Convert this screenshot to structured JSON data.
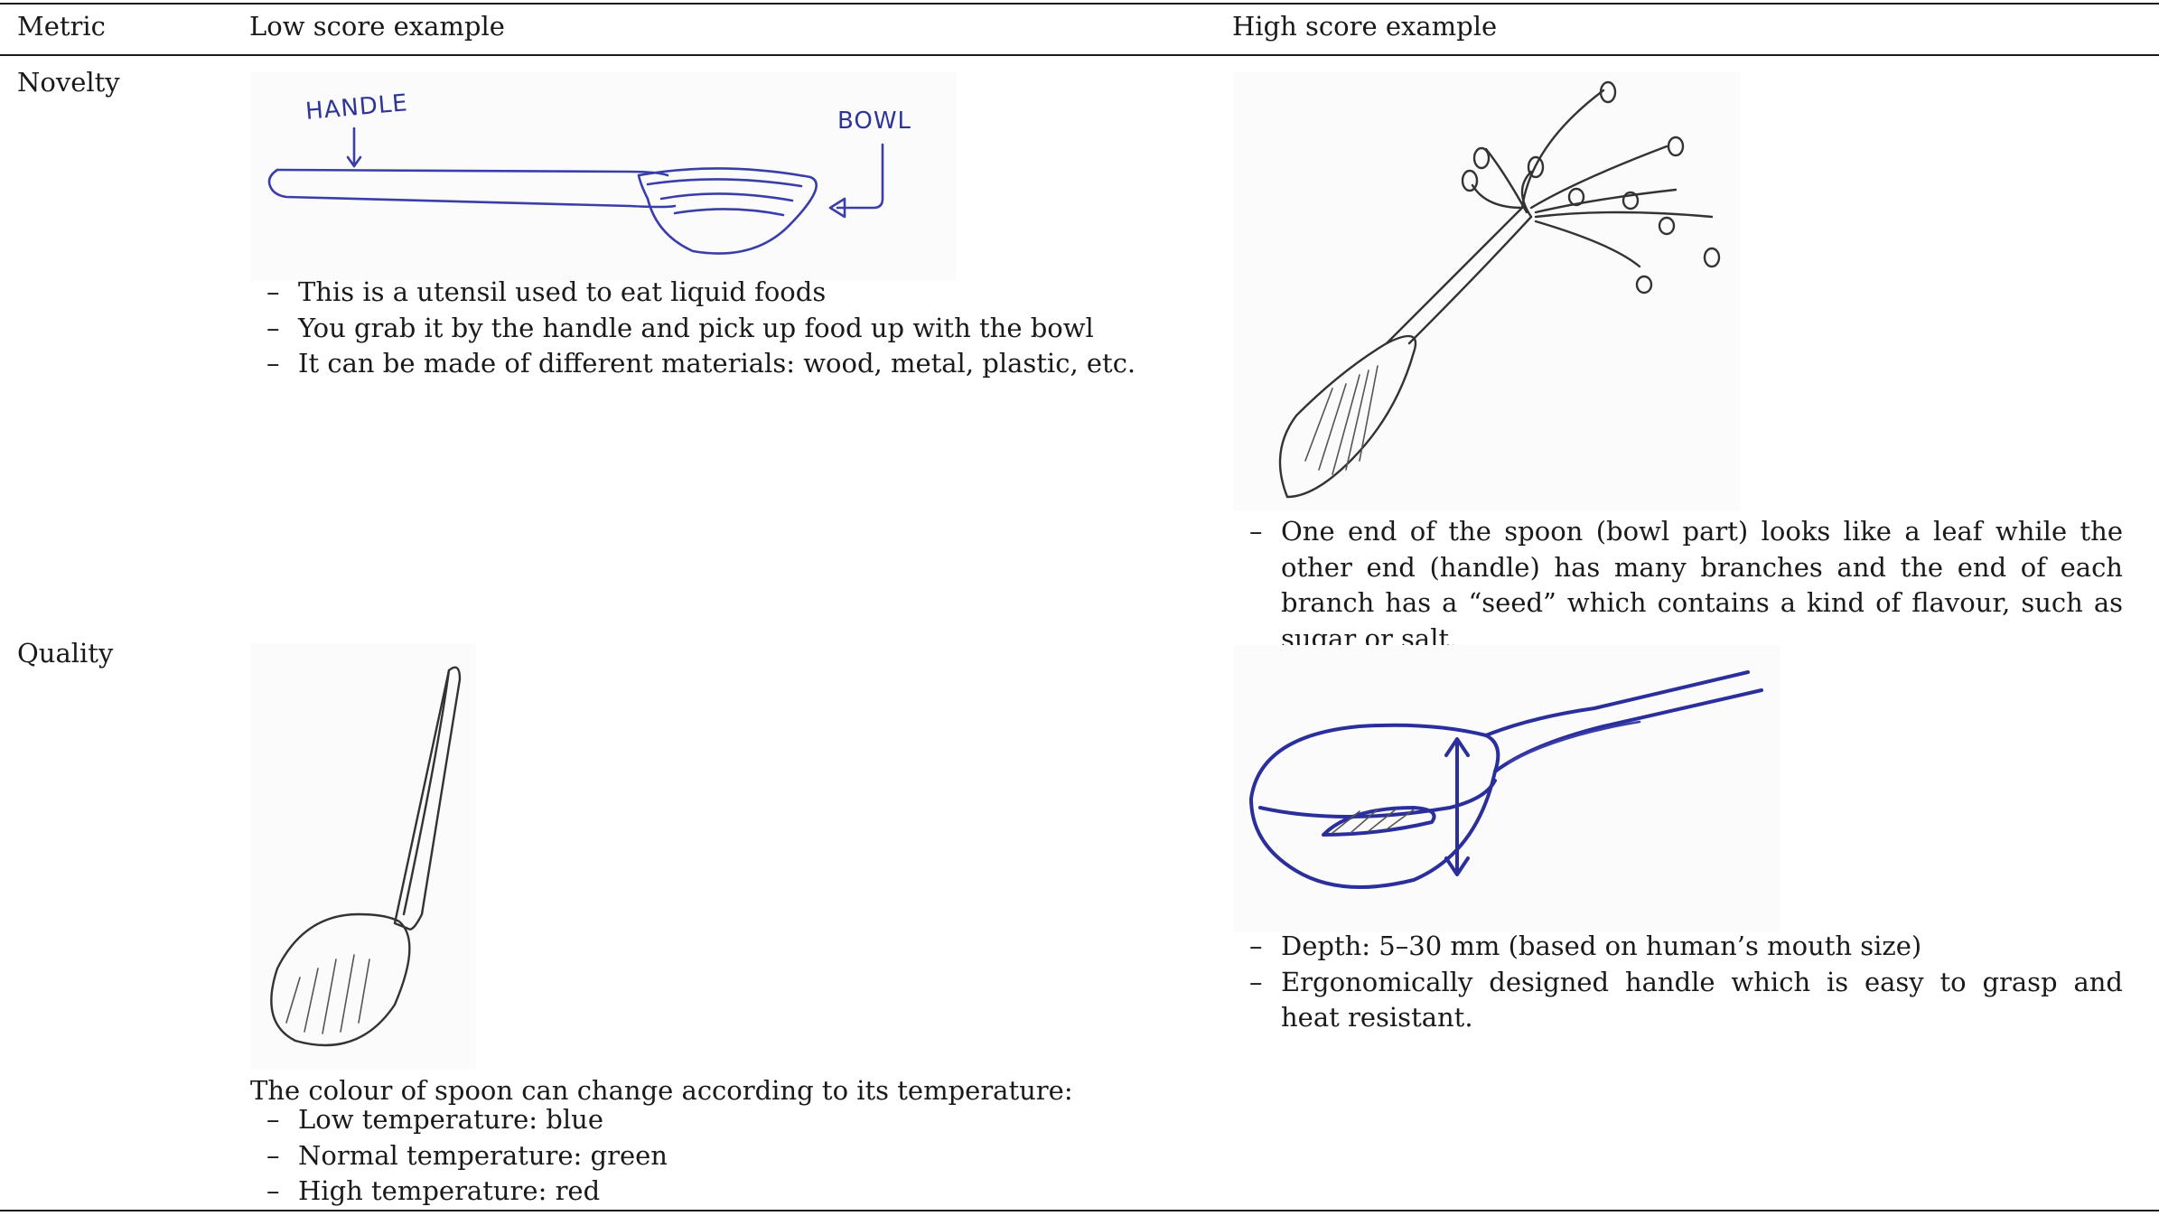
{
  "header": {
    "col_metric": "Metric",
    "col_low": "Low score example",
    "col_high": "High score example"
  },
  "rows": [
    {
      "metric": "Novelty",
      "low": {
        "sketch_labels": [
          "HANDLE",
          "BOWL"
        ],
        "bullets": [
          "This is a utensil used to eat liquid foods",
          "You grab it by the handle and pick up food up with the bowl",
          "It can be made of different materials: wood, metal, plastic, etc."
        ]
      },
      "high": {
        "bullets": [
          "One end of the spoon (bowl part) looks like a leaf while the other end (handle) has many branches and the end of each branch has a “seed” which contains a kind of flavour, such as sugar or salt."
        ]
      }
    },
    {
      "metric": "Quality",
      "low": {
        "intro": "The colour of spoon can change according to its temperature:",
        "bullets": [
          "Low temperature: blue",
          "Normal temperature: green",
          "High temperature: red"
        ]
      },
      "high": {
        "bullets": [
          "Depth: 5–30 mm (based on human’s mouth size)",
          "Ergonomically designed handle which is easy to grasp and heat resistant."
        ]
      }
    }
  ]
}
